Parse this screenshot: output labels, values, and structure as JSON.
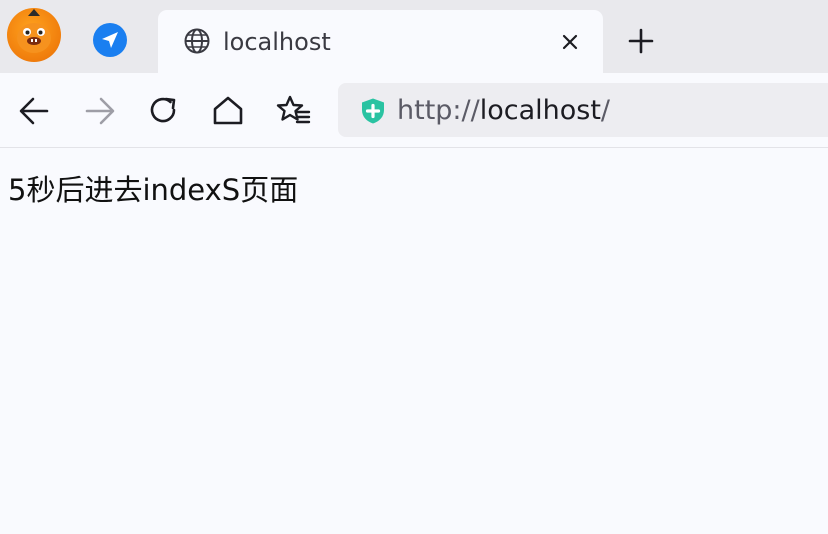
{
  "browser": {
    "tab": {
      "title": "localhost",
      "icon": "globe-icon"
    },
    "icons": {
      "profile": "fox-avatar-icon",
      "extension": "paper-plane-icon",
      "tab_close": "close-icon",
      "new_tab": "plus-icon"
    },
    "toolbar": {
      "back_icon": "arrow-left-icon",
      "forward_icon": "arrow-right-icon",
      "reload_icon": "reload-icon",
      "home_icon": "home-icon",
      "bookmark_icon": "star-list-icon"
    },
    "address_bar": {
      "security_icon": "shield-plus-icon",
      "url_scheme": "http://",
      "url_host": "localhost",
      "url_path": "/"
    },
    "colors": {
      "tabstrip_bg": "#e9e9ed",
      "page_bg": "#f9fafe",
      "urlbar_bg": "#ededf1",
      "shield_green": "#2ac3a2",
      "extension_blue": "#1a7ff0",
      "profile_orange": "#f07d0c"
    }
  },
  "page": {
    "message": "5秒后进去indexS页面"
  }
}
